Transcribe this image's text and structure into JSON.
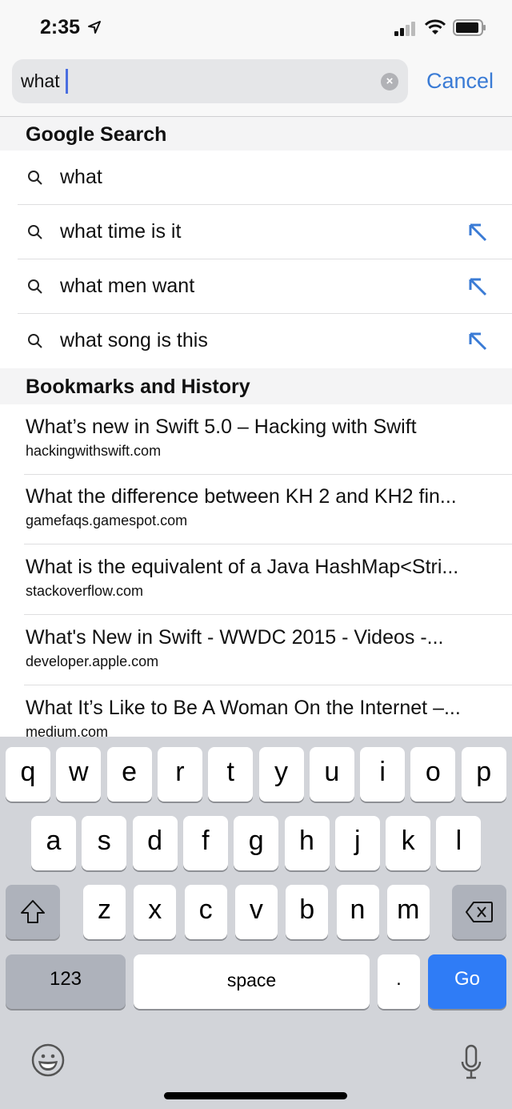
{
  "status": {
    "time": "2:35",
    "location_icon": "location-arrow-icon",
    "signal_icon": "cellular-signal-icon",
    "wifi_icon": "wifi-icon",
    "battery_icon": "battery-icon"
  },
  "search": {
    "value": "what",
    "cancel_label": "Cancel"
  },
  "google": {
    "header": "Google Search",
    "items": [
      "what",
      "what time is it",
      "what men want",
      "what song is this"
    ]
  },
  "history": {
    "header": "Bookmarks and History",
    "items": [
      {
        "title": "What’s new in Swift 5.0 – Hacking with Swift",
        "domain": "hackingwithswift.com"
      },
      {
        "title": "What the difference between KH 2 and KH2 fin...",
        "domain": "gamefaqs.gamespot.com"
      },
      {
        "title": "What is the equivalent of a Java HashMap<Stri...",
        "domain": "stackoverflow.com"
      },
      {
        "title": "What's New in Swift - WWDC 2015 - Videos -...",
        "domain": "developer.apple.com"
      },
      {
        "title": "What It’s Like to Be A Woman On the Internet –...",
        "domain": "medium.com"
      }
    ]
  },
  "keyboard": {
    "row1": [
      "q",
      "w",
      "e",
      "r",
      "t",
      "y",
      "u",
      "i",
      "o",
      "p"
    ],
    "row2": [
      "a",
      "s",
      "d",
      "f",
      "g",
      "h",
      "j",
      "k",
      "l"
    ],
    "row3": [
      "z",
      "x",
      "c",
      "v",
      "b",
      "n",
      "m"
    ],
    "numbers": "123",
    "space": "space",
    "period": ".",
    "go": "Go"
  },
  "colors": {
    "accent": "#3a7bd5",
    "go_key": "#2f7cf6"
  }
}
